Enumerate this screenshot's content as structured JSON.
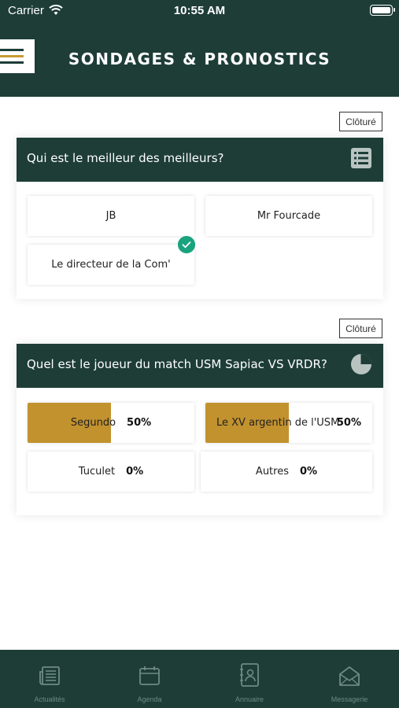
{
  "status_bar": {
    "carrier": "Carrier",
    "time": "10:55 AM"
  },
  "header": {
    "title": "SONDAGES & PRONOSTICS"
  },
  "polls": [
    {
      "status": "Clôturé",
      "question": "Qui est le meilleur des meilleurs?",
      "icon": "list-icon",
      "options": [
        {
          "label": "JB"
        },
        {
          "label": "Mr Fourcade"
        },
        {
          "label": "Le directeur de la Com'",
          "selected": true
        }
      ]
    },
    {
      "status": "Clôturé",
      "question": "Quel est le joueur du match USM Sapiac VS VRDR?",
      "icon": "pie-chart-icon",
      "options": [
        {
          "label": "Segundo",
          "percent": "50%",
          "fraction": 0.5
        },
        {
          "label": "Le XV argentin de l'USM",
          "percent": "50%",
          "fraction": 0.5
        },
        {
          "label": "Tuculet",
          "percent": "0%",
          "fraction": 0
        },
        {
          "label": "Autres",
          "percent": "0%",
          "fraction": 0
        }
      ]
    }
  ],
  "tabbar": [
    {
      "label": "Actualités",
      "icon": "newspaper-icon"
    },
    {
      "label": "Agenda",
      "icon": "calendar-icon"
    },
    {
      "label": "Annuaire",
      "icon": "contacts-book-icon"
    },
    {
      "label": "Messagerie",
      "icon": "mail-icon"
    }
  ],
  "colors": {
    "primary": "#1e3d37",
    "accent": "#c2922e",
    "check": "#1aa37f",
    "tab_inactive": "#6e8a83"
  }
}
